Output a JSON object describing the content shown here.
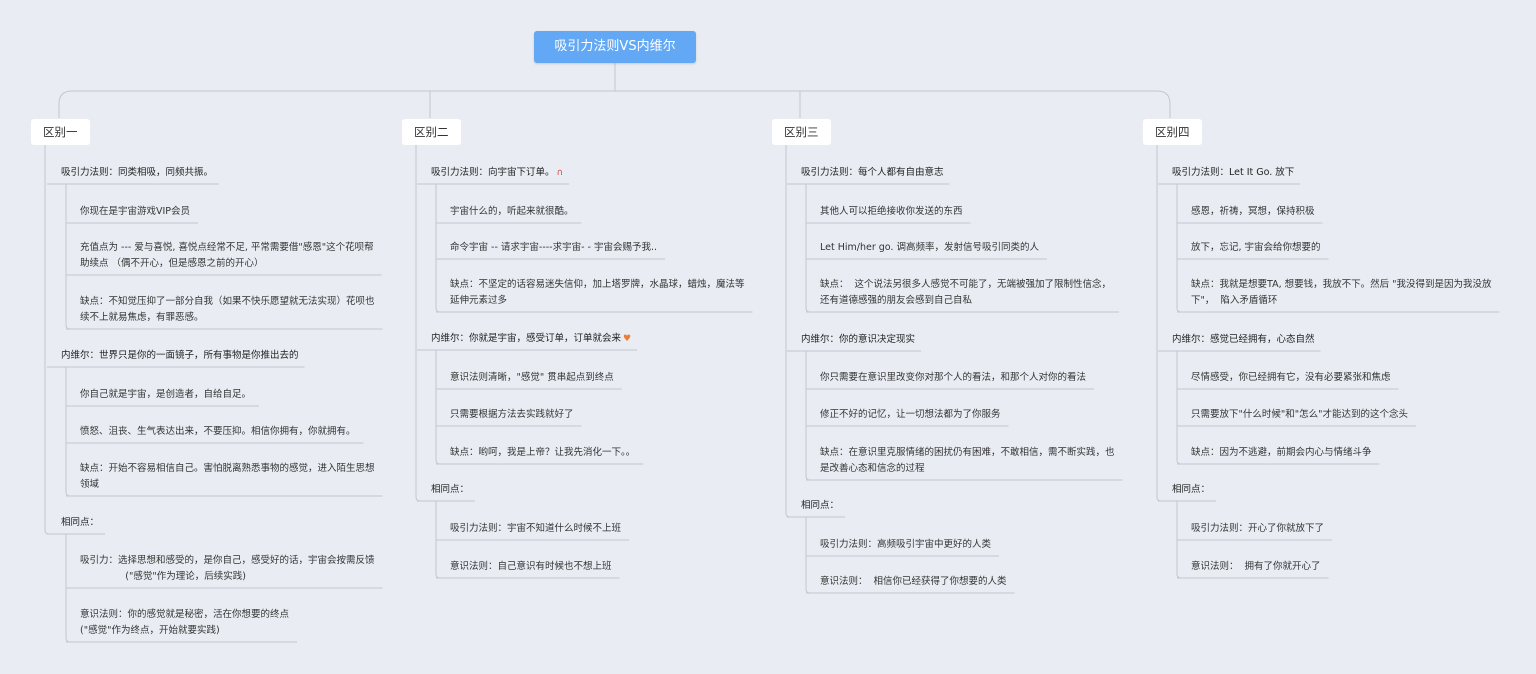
{
  "root": {
    "title": "吸引力法则VS内维尔"
  },
  "branches": [
    {
      "label": "区别一",
      "sec1_title": "吸引力法则：同类相吸，同频共振。",
      "sec1_items": [
        "你现在是宇宙游戏VIP会员",
        "充值点为 --- 爱与喜悦, 喜悦点经常不足, 平常需要借\"感恩\"这个花呗帮\n助续点 （偶不开心，但是感恩之前的开心）",
        "缺点：不知觉压抑了一部分自我（如果不快乐愿望就无法实现）花呗也\n续不上就易焦虑，有罪恶感。"
      ],
      "sec2_title": "内维尔：世界只是你的一面镜子，所有事物是你推出去的",
      "sec2_items": [
        "你自己就是宇宙，是创造者，自给自足。",
        "愤怒、沮丧、生气表达出来，不要压抑。相信你拥有，你就拥有。",
        "缺点：开始不容易相信自己。害怕脱离熟悉事物的感觉，进入陌生思想\n领域"
      ],
      "sec3_title": "相同点：",
      "sec3_items": [
        "吸引力：选择思想和感受的，是你自己，感受好的话，宇宙会按需反馈\n               (\"感觉\"作为理论，后续实践)",
        "意识法则：你的感觉就是秘密，活在你想要的终点\n(\"感觉\"作为终点，开始就要实践)"
      ]
    },
    {
      "label": "区别二",
      "sec1_title": "吸引力法则：向宇宙下订单。",
      "sec1_items": [
        "宇宙什么的，听起来就很酷。",
        "命令宇宙 -- 请求宇宙----求宇宙- - 宇宙会赐予我..",
        "缺点：不坚定的话容易迷失信仰，加上塔罗牌，水晶球，蜡烛，魔法等\n延伸元素过多"
      ],
      "sec2_title": "内维尔：你就是宇宙，感受订单，订单就会来",
      "sec2_items": [
        "意识法则清晰，\"感觉\" 贯串起点到终点",
        "只需要根据方法去实践就好了",
        "缺点：哟呵，我是上帝？让我先消化一下。。"
      ],
      "sec3_title": "相同点：",
      "sec3_items": [
        "吸引力法则：宇宙不知道什么时候不上班",
        "意识法则：自己意识有时候也不想上班"
      ]
    },
    {
      "label": "区别三",
      "sec1_title": "吸引力法则：每个人都有自由意志",
      "sec1_items": [
        "其他人可以拒绝接收你发送的东西",
        "Let Him/her go. 调高频率，发射信号吸引同类的人",
        "缺点：  这个说法另很多人感觉不可能了，无端被强加了限制性信念，\n还有道德感强的朋友会感到自己自私"
      ],
      "sec2_title": "内维尔：你的意识决定现实",
      "sec2_items": [
        "你只需要在意识里改变你对那个人的看法，和那个人对你的看法",
        "修正不好的记忆，让一切想法都为了你服务",
        "缺点：在意识里克服情绪的困扰仍有困难，不敢相信，需不断实践，也\n是改善心态和信念的过程"
      ],
      "sec3_title": "相同点：",
      "sec3_items": [
        "吸引力法则：高频吸引宇宙中更好的人类",
        "意识法则：  相信你已经获得了你想要的人类"
      ]
    },
    {
      "label": "区别四",
      "sec1_title": "吸引力法则：Let It Go. 放下",
      "sec1_items": [
        "感恩，祈祷，冥想，保持积极",
        "放下，忘记, 宇宙会给你想要的",
        "缺点：我就是想要TA, 想要钱，我放不下。然后 \"我没得到是因为我没放\n下\"，  陷入矛盾循环"
      ],
      "sec2_title": "内维尔：感觉已经拥有，心态自然",
      "sec2_items": [
        "尽情感受，你已经拥有它，没有必要紧张和焦虑",
        "只需要放下\"什么时候\"和\"怎么\"才能达到的这个念头",
        "缺点：因为不逃避，前期会内心与情绪斗争"
      ],
      "sec3_title": "相同点：",
      "sec3_items": [
        "吸引力法则：开心了你就放下了",
        "意识法则：  拥有了你就开心了"
      ]
    }
  ],
  "icons": {
    "magnet": "magnet-icon",
    "heart": "heart-icon"
  },
  "colors": {
    "root_bg": "#62a8f5",
    "line": "#c4c8ce",
    "background": "#e9edf3"
  }
}
